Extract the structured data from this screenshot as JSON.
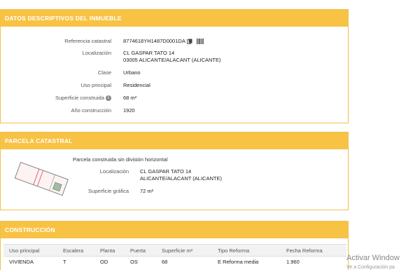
{
  "datos": {
    "title": "DATOS DESCRIPTIVOS DEL INMUEBLE",
    "referencia_label": "Referencia catastral",
    "referencia_value": "8774618YH1487D0001DA",
    "localizacion_label": "Localización",
    "localizacion_line1": "CL GASPAR TATO 14",
    "localizacion_line2": "03005 ALICANTE/ALACANT (ALICANTE)",
    "clase_label": "Clase",
    "clase_value": "Urbano",
    "uso_label": "Uso principal",
    "uso_value": "Residencial",
    "superficie_label": "Superficie construida",
    "superficie_value": "68 m²",
    "anio_label": "Año construcción",
    "anio_value": "1920"
  },
  "parcela": {
    "title": "PARCELA CATASTRAL",
    "description": "Parcela construida sin división horizontal",
    "localizacion_label": "Localización",
    "localizacion_line1": "CL GASPAR TATO 14",
    "localizacion_line2": "ALICANTE/ALACANT (ALICANTE)",
    "superficie_label": "Superficie gráfica",
    "superficie_value": "72 m²"
  },
  "construccion": {
    "title": "CONSTRUCCIÓN",
    "headers": [
      "Uso principal",
      "Escalera",
      "Planta",
      "Puerta",
      "Superficie m²",
      "Tipo Reforma",
      "Fecha Reforma"
    ],
    "rows": [
      [
        "VIVIENDA",
        "T",
        "OD",
        "OS",
        "68",
        "E Reforma media",
        "1.960"
      ]
    ]
  },
  "watermark": {
    "line1": "Activar Window",
    "line2": "Ve a Configuración pa"
  },
  "colors": {
    "header_bg": "#f8c244",
    "border": "#f0c14b"
  },
  "icons": {
    "info": "info-icon",
    "copy": "copy-icon",
    "barcode": "barcode-icon",
    "parcel_map": "parcel-map-icon"
  }
}
